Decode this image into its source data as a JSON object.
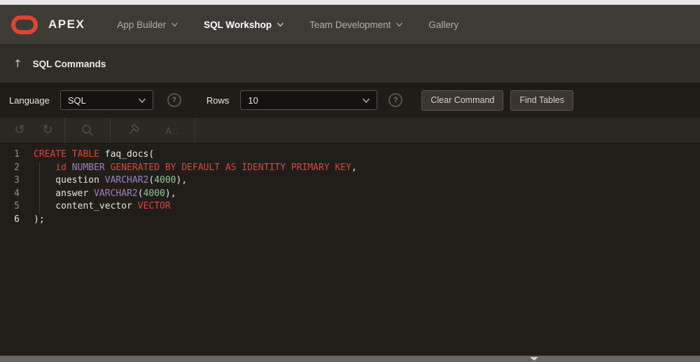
{
  "topnav": {
    "brand": "APEX",
    "items": [
      {
        "label": "App Builder",
        "has_dropdown": true,
        "active": false
      },
      {
        "label": "SQL Workshop",
        "has_dropdown": true,
        "active": true
      },
      {
        "label": "Team Development",
        "has_dropdown": true,
        "active": false
      },
      {
        "label": "Gallery",
        "has_dropdown": false,
        "active": false
      }
    ]
  },
  "breadcrumb": {
    "up_icon": "↑",
    "title": "SQL Commands"
  },
  "controls": {
    "language_label": "Language",
    "language_value": "SQL",
    "rows_label": "Rows",
    "rows_value": "10",
    "help_glyph": "?",
    "clear_button": "Clear Command",
    "find_tables_button": "Find Tables"
  },
  "toolbar": {
    "undo_glyph": "↺",
    "redo_glyph": "↻",
    "autocomplete_label": "A::"
  },
  "editor": {
    "lines": [
      {
        "number": "1",
        "segments": [
          {
            "text": "CREATE TABLE",
            "type": "keyword"
          },
          {
            "text": " faq_docs(",
            "type": "plain"
          }
        ]
      },
      {
        "number": "2",
        "segments": [
          {
            "text": "    id",
            "type": "keyword"
          },
          {
            "text": " NUMBER",
            "type": "datatype"
          },
          {
            "text": " GENERATED BY DEFAULT AS IDENTITY PRIMARY KEY",
            "type": "keyword"
          },
          {
            "text": ",",
            "type": "plain"
          }
        ]
      },
      {
        "number": "3",
        "segments": [
          {
            "text": "    question",
            "type": "plain"
          },
          {
            "text": " VARCHAR2",
            "type": "datatype"
          },
          {
            "text": "(",
            "type": "plain"
          },
          {
            "text": "4000",
            "type": "number"
          },
          {
            "text": "),",
            "type": "plain"
          }
        ]
      },
      {
        "number": "4",
        "segments": [
          {
            "text": "    answer",
            "type": "plain"
          },
          {
            "text": " VARCHAR2",
            "type": "datatype"
          },
          {
            "text": "(",
            "type": "plain"
          },
          {
            "text": "4000",
            "type": "number"
          },
          {
            "text": "),",
            "type": "plain"
          }
        ]
      },
      {
        "number": "5",
        "segments": [
          {
            "text": "    content_vector",
            "type": "plain"
          },
          {
            "text": " VECTOR",
            "type": "keyword"
          }
        ]
      },
      {
        "number": "6",
        "segments": [
          {
            "text": ");",
            "type": "plain"
          }
        ]
      }
    ]
  },
  "colors": {
    "brand_red": "#de452f",
    "tok_keyword": "#d8473c",
    "tok_datatype": "#9d80c0",
    "tok_number": "#8fc795",
    "tok_plain": "#e6e4e0",
    "navbar_bg": "#3e3a35",
    "breadcrumb_bg": "#312d28",
    "editor_bg": "#211e1a",
    "splitter_bg": "#6b655f"
  }
}
